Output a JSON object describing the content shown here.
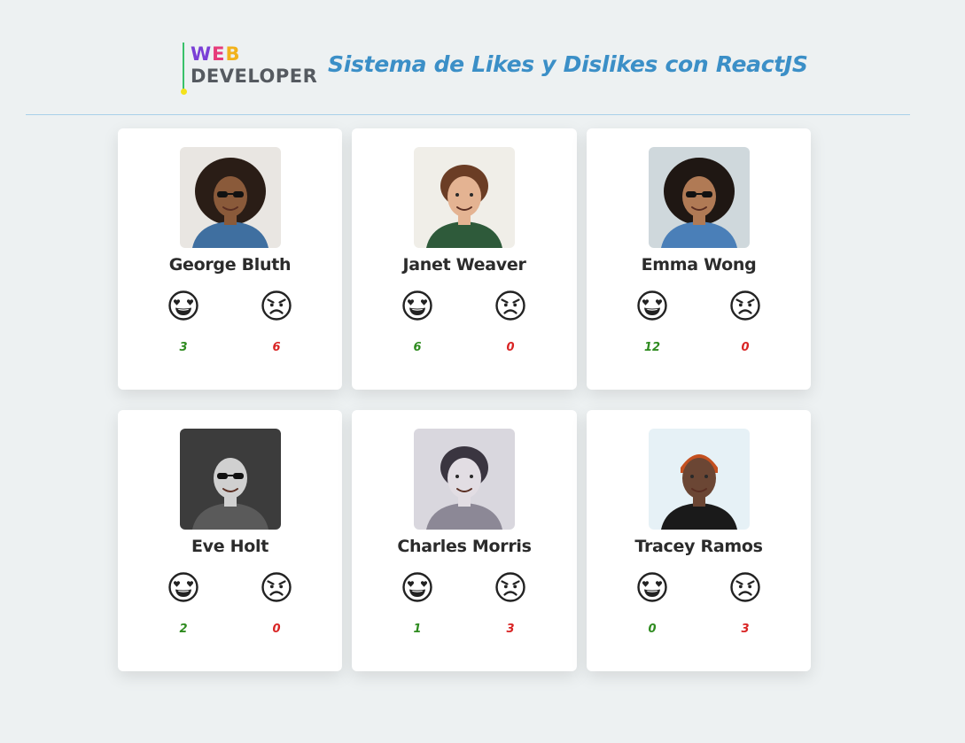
{
  "logo": {
    "letters_web": [
      {
        "char": "W",
        "color": "#7a3fd6"
      },
      {
        "char": "E",
        "color": "#e63c7a"
      },
      {
        "char": "B",
        "color": "#f2b21b"
      }
    ],
    "word_developer": "DEVELOPER"
  },
  "title": "Sistema de Likes y Dislikes con ReactJS",
  "colors": {
    "accent": "#3b8fc7",
    "like_count": "#2e8b1f",
    "dislike_count": "#d92424"
  },
  "icons": {
    "like": "heart-eyes-face-icon",
    "dislike": "angry-face-icon"
  },
  "cards": [
    {
      "name": "George Bluth",
      "likes": "3",
      "dislikes": "6"
    },
    {
      "name": "Janet Weaver",
      "likes": "6",
      "dislikes": "0"
    },
    {
      "name": "Emma Wong",
      "likes": "12",
      "dislikes": "0"
    },
    {
      "name": "Eve Holt",
      "likes": "2",
      "dislikes": "0"
    },
    {
      "name": "Charles Morris",
      "likes": "1",
      "dislikes": "3"
    },
    {
      "name": "Tracey Ramos",
      "likes": "0",
      "dislikes": "3"
    }
  ]
}
